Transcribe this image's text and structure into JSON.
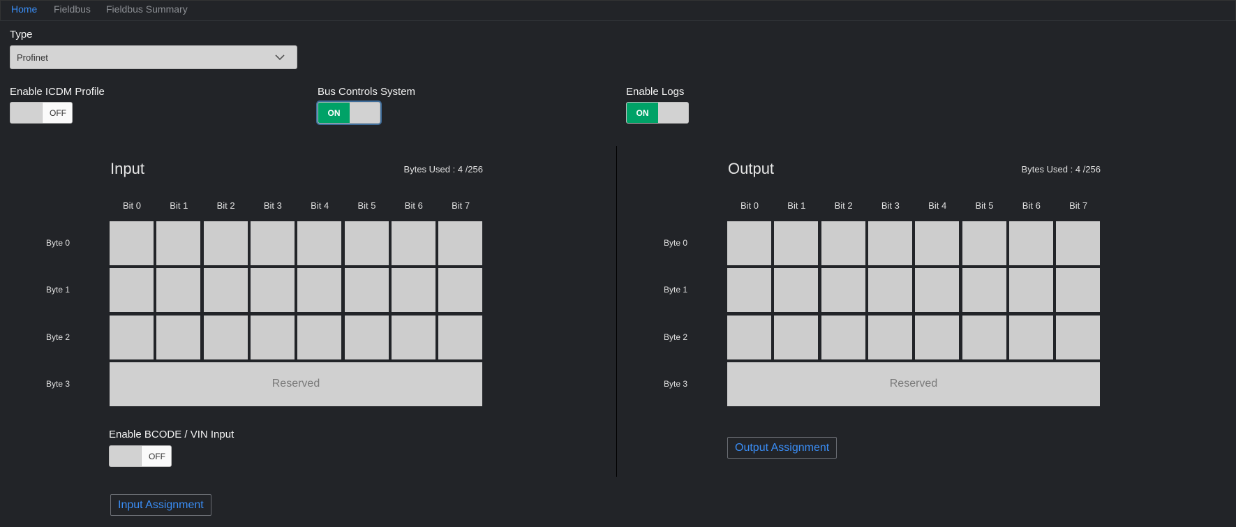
{
  "nav": {
    "tabs": [
      {
        "label": "Home",
        "active": true
      },
      {
        "label": "Fieldbus",
        "active": false
      },
      {
        "label": "Fieldbus Summary",
        "active": false
      }
    ]
  },
  "type": {
    "label": "Type",
    "value": "Profinet",
    "icon": "chevron-down-icon"
  },
  "toggles": {
    "icdm": {
      "label": "Enable ICDM Profile",
      "state": "OFF"
    },
    "bus_controls": {
      "label": "Bus Controls System",
      "state": "ON"
    },
    "logs": {
      "label": "Enable Logs",
      "state": "ON"
    },
    "bcode": {
      "label": "Enable BCODE / VIN Input",
      "state": "OFF"
    }
  },
  "colors": {
    "accent": "#3a8df5",
    "on": "#00a267",
    "cell": "#cdcdcd",
    "background": "#222428"
  },
  "input": {
    "title": "Input",
    "bytes_used": "Bytes Used : 4 /256",
    "bit_headers": [
      "Bit 0",
      "Bit 1",
      "Bit 2",
      "Bit 3",
      "Bit 4",
      "Bit 5",
      "Bit 6",
      "Bit 7"
    ],
    "bytes": [
      "Byte 0",
      "Byte 1",
      "Byte 2",
      "Byte 3"
    ],
    "reserved_label": "Reserved",
    "assignment_button": "Input Assignment"
  },
  "output": {
    "title": "Output",
    "bytes_used": "Bytes Used : 4 /256",
    "bit_headers": [
      "Bit 0",
      "Bit 1",
      "Bit 2",
      "Bit 3",
      "Bit 4",
      "Bit 5",
      "Bit 6",
      "Bit 7"
    ],
    "bytes": [
      "Byte 0",
      "Byte 1",
      "Byte 2",
      "Byte 3"
    ],
    "reserved_label": "Reserved",
    "assignment_button": "Output Assignment"
  }
}
